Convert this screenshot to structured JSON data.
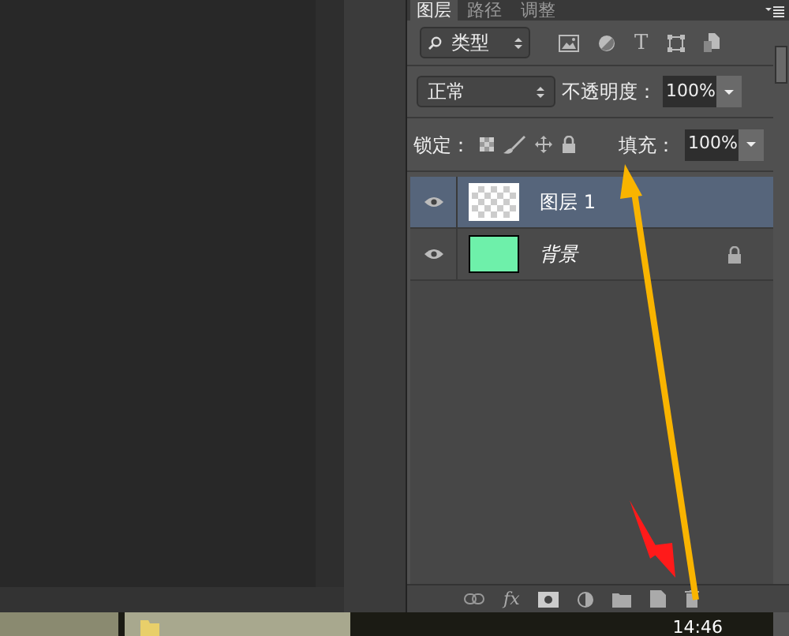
{
  "panel_tabs": [
    {
      "label": "图层",
      "selected": true
    },
    {
      "label": "路径",
      "selected": false
    },
    {
      "label": "调整",
      "selected": false
    }
  ],
  "filter": {
    "value": "类型",
    "type_icon": "T"
  },
  "blend_mode": {
    "value": "正常"
  },
  "opacity": {
    "label": "不透明度：",
    "value": "100%"
  },
  "lock": {
    "label": "锁定："
  },
  "fill": {
    "label": "填充：",
    "value": "100%"
  },
  "layers": [
    {
      "name": "图层 1",
      "kind": "layer",
      "selected": true,
      "visible": true,
      "locked": false
    },
    {
      "name": "背景",
      "kind": "background",
      "color": "#6ef0aa",
      "selected": false,
      "visible": true,
      "locked": true
    }
  ],
  "bottom_toolbar": {
    "fx_icon": "fx"
  },
  "taskbar": {
    "time": "14:46"
  }
}
